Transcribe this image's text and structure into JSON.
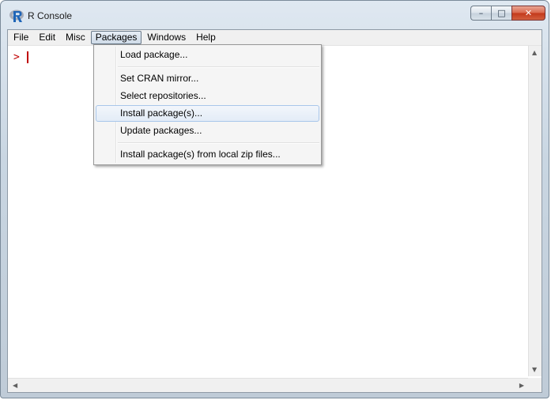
{
  "window": {
    "title": "R Console",
    "controls": {
      "minimize": "–",
      "maximize": "□",
      "close": "✕"
    }
  },
  "menubar": {
    "items": [
      "File",
      "Edit",
      "Misc",
      "Packages",
      "Windows",
      "Help"
    ],
    "open_menu": "Packages"
  },
  "packages_menu": {
    "items": [
      "Load package...",
      "Set CRAN mirror...",
      "Select repositories...",
      "Install package(s)...",
      "Update packages...",
      "Install package(s) from local zip files..."
    ],
    "highlighted": "Install package(s)..."
  },
  "console": {
    "prompt": ">"
  },
  "icons": {
    "app": "r-logo-icon",
    "scroll_up": "arrow-up-icon",
    "scroll_down": "arrow-down-icon",
    "scroll_left": "arrow-left-icon",
    "scroll_right": "arrow-right-icon"
  },
  "colors": {
    "prompt": "#c00000",
    "highlight_border": "#a8c6ea"
  }
}
